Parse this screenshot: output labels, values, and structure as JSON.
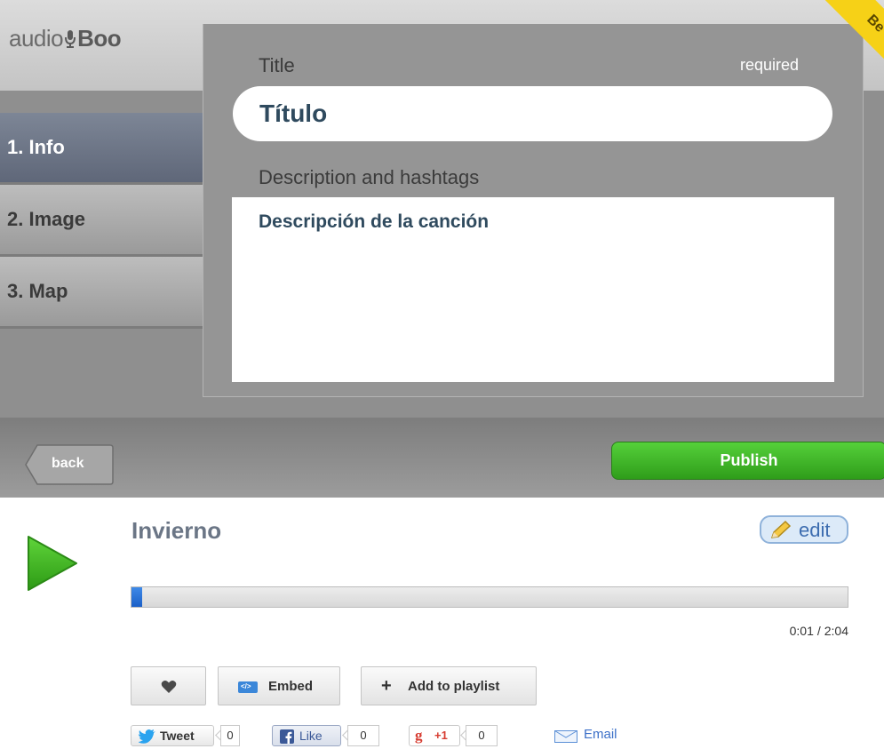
{
  "app": {
    "logo_prefix": "audio",
    "logo_suffix": "Boo",
    "beta_label": "Be",
    "sidebar": {
      "items": [
        {
          "label": "1. Info",
          "active": true
        },
        {
          "label": "2. Image",
          "active": false
        },
        {
          "label": "3. Map",
          "active": false
        }
      ]
    },
    "form": {
      "title_label": "Title",
      "required_label": "required",
      "title_value": "Título",
      "description_label": "Description and hashtags",
      "description_value": "Descripción de la canción"
    },
    "footer": {
      "back_label": "back",
      "publish_label": "Publish"
    }
  },
  "player": {
    "track_title": "Invierno",
    "edit_label": "edit",
    "progress_fraction": 0.0081,
    "time_current": "0:01",
    "time_separator": "/",
    "time_total": "2:04",
    "actions": {
      "embed_label": "Embed",
      "playlist_plus": "+",
      "playlist_label": "Add to playlist"
    },
    "social": {
      "tweet_label": "Tweet",
      "tweet_count": "0",
      "like_label": "Like",
      "like_count": "0",
      "gplus_label": "+1",
      "gplus_count": "0",
      "email_label": "Email"
    }
  },
  "colors": {
    "accent_green": "#3cb826",
    "link_blue": "#3c70c8",
    "progress_blue": "#1b5fc7",
    "title_text": "#2f4a5e"
  }
}
